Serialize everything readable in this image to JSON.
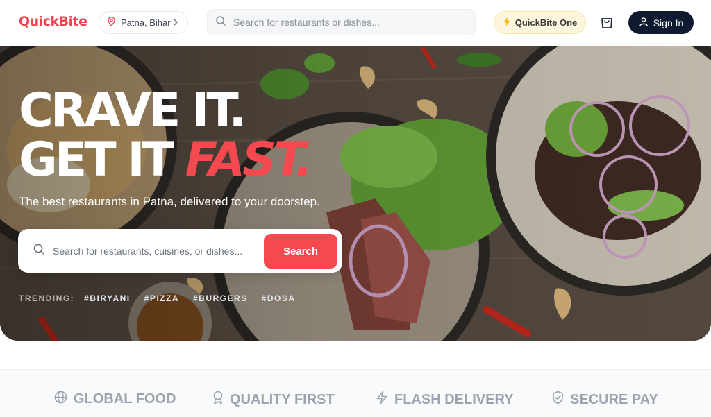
{
  "header": {
    "logo": "QuickBite",
    "location": "Patna, Bihar",
    "search_placeholder": "Search for restaurants or dishes...",
    "membership": "QuickBite One",
    "sign_in": "Sign In"
  },
  "hero": {
    "headline_line1": "CRAVE IT.",
    "headline_line2a": "GET IT",
    "headline_line2b": "FAST.",
    "tagline": "The best restaurants in Patna, delivered to your doorstep.",
    "search_placeholder": "Search for restaurants, cuisines, or dishes...",
    "search_button": "Search",
    "trending_label": "TRENDING:",
    "trending": [
      "#BIRYANI",
      "#PIZZA",
      "#BURGERS",
      "#DOSA"
    ]
  },
  "features": [
    {
      "label": "GLOBAL FOOD",
      "icon": "globe-icon"
    },
    {
      "label": "QUALITY FIRST",
      "icon": "award-icon"
    },
    {
      "label": "FLASH DELIVERY",
      "icon": "lightning-icon"
    },
    {
      "label": "SECURE PAY",
      "icon": "shield-icon"
    }
  ],
  "colors": {
    "brand": "#ef4352",
    "accent": "#f5484f",
    "navy": "#0f1a30",
    "gold": "#f5b400"
  }
}
